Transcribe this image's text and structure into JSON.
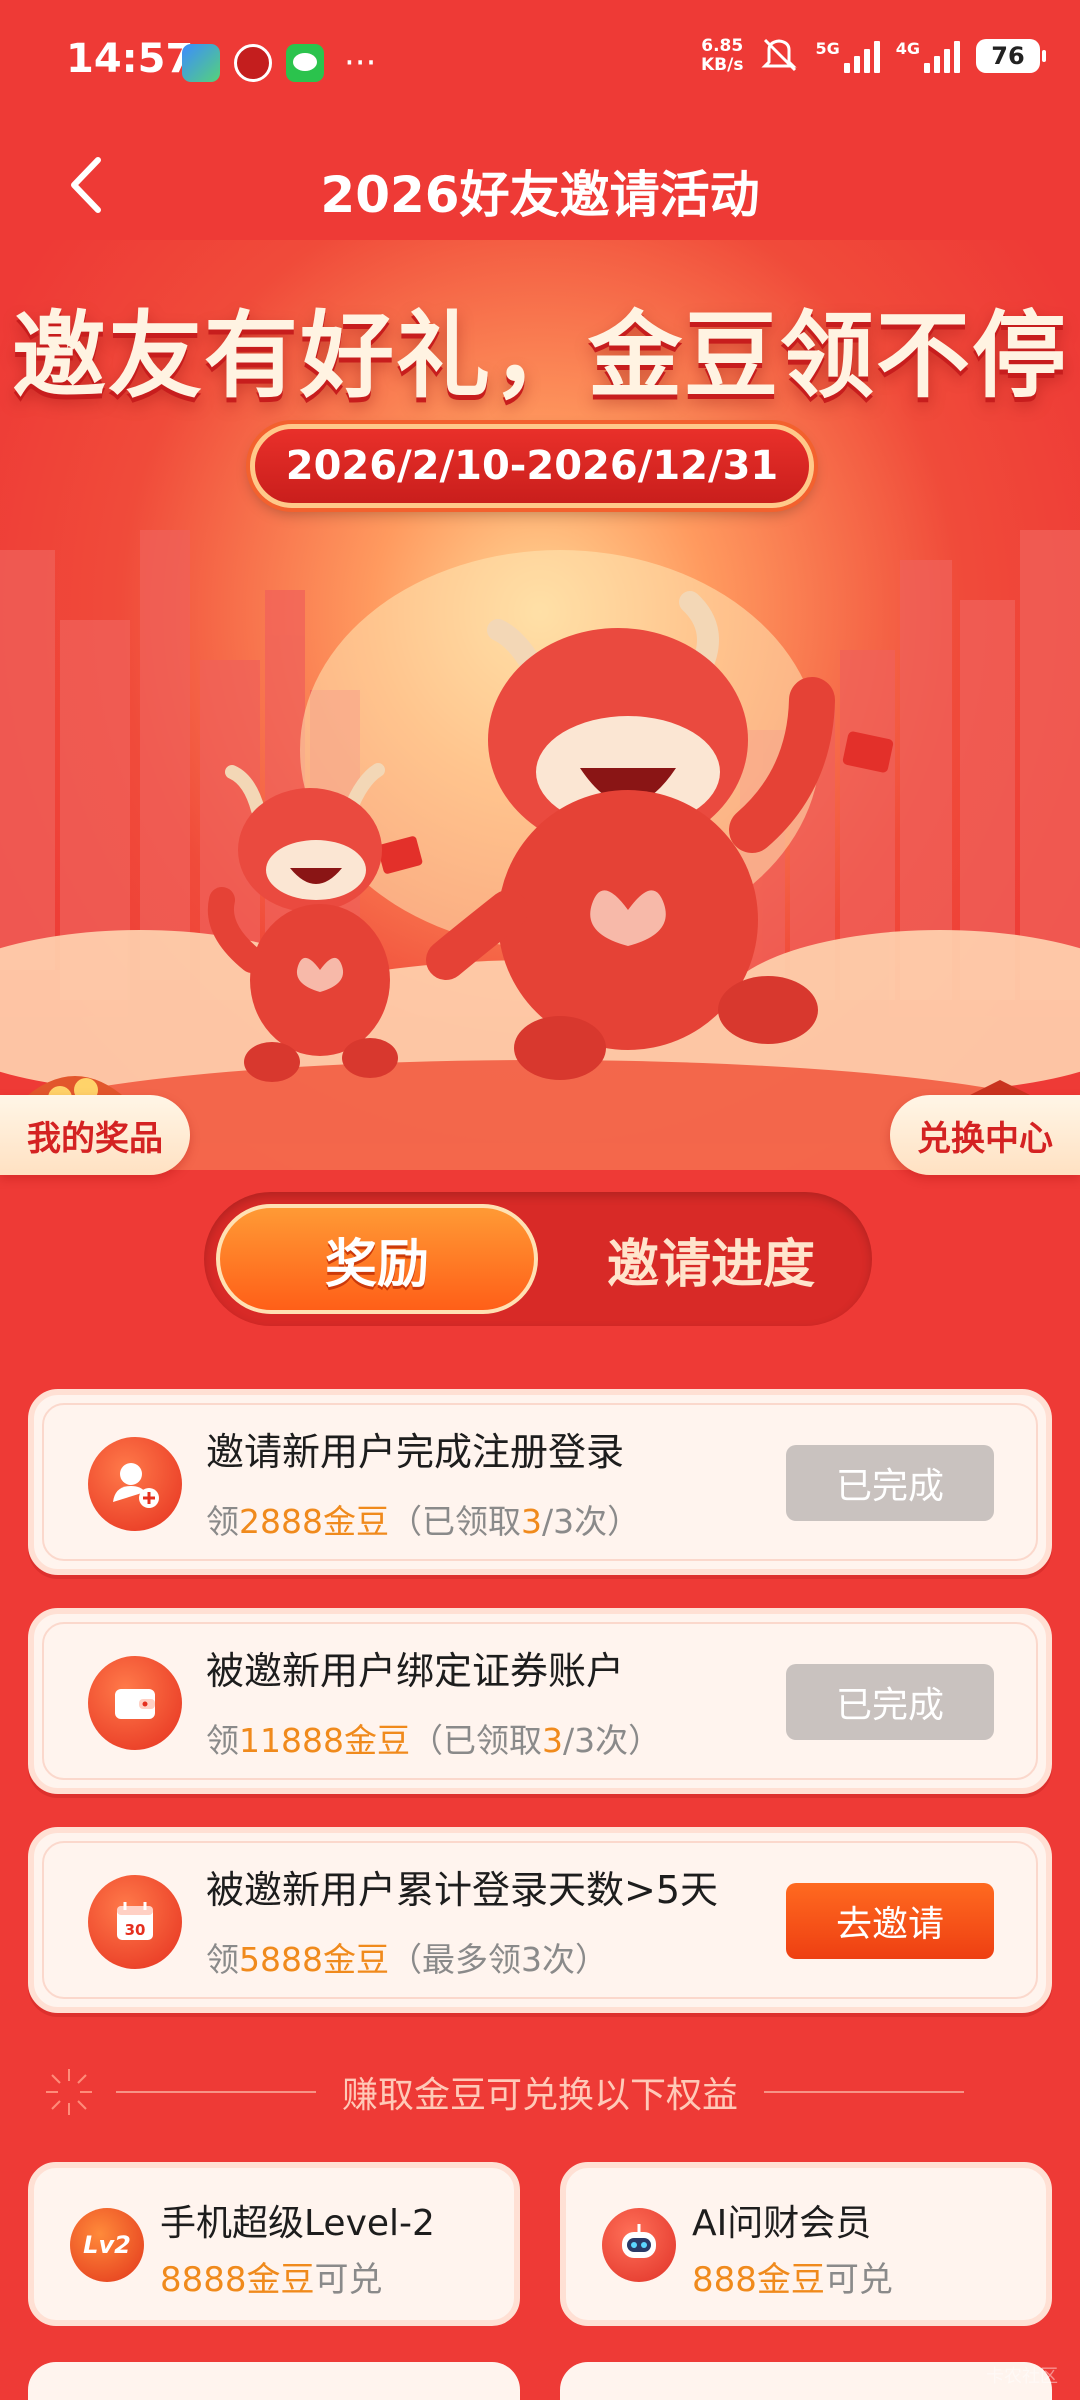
{
  "status_bar": {
    "time": "14:57",
    "speed_value": "6.85",
    "speed_unit": "KB/s",
    "net1": "5G",
    "net2": "4G",
    "battery": "76"
  },
  "header": {
    "title": "2026好友邀请活动",
    "back_icon": "chevron-left-icon"
  },
  "hero": {
    "headline": "邀友有好礼，金豆领不停",
    "date_range": "2026/2/10-2026/12/31",
    "left_tag": "我的奖品",
    "right_tag": "兑换中心"
  },
  "tabs": [
    {
      "label": "奖励",
      "active": true
    },
    {
      "label": "邀请进度",
      "active": false
    }
  ],
  "tasks": [
    {
      "icon": "add-user-icon",
      "title": "邀请新用户完成注册登录",
      "prefix": "领",
      "reward": "2888金豆",
      "detail_open": "（已领取",
      "claimed": "3",
      "detail_close": "/3次）",
      "button": "已完成",
      "done": true
    },
    {
      "icon": "wallet-icon",
      "title": "被邀新用户绑定证券账户",
      "prefix": "领",
      "reward": "11888金豆",
      "detail_open": "（已领取",
      "claimed": "3",
      "detail_close": "/3次）",
      "button": "已完成",
      "done": true
    },
    {
      "icon": "calendar-icon",
      "title": "被邀新用户累计登录天数>5天",
      "prefix": "领",
      "reward": "5888金豆",
      "detail": "（最多领3次）",
      "calendar_day": "30",
      "button": "去邀请",
      "done": false
    }
  ],
  "benefits_divider": "赚取金豆可兑换以下权益",
  "benefits": [
    {
      "icon": "level-badge-icon",
      "icon_text": "Lv2",
      "title": "手机超级Level-2",
      "price": "8888金豆",
      "suffix": "可兑"
    },
    {
      "icon": "robot-icon",
      "title": "AI问财会员",
      "price": "888金豆",
      "suffix": "可兑"
    }
  ],
  "watermark": "卡农社区",
  "colors": {
    "background": "#ee3a36",
    "accent_orange": "#f08a1c",
    "button_go": "#ee3f12",
    "button_done": "#c9c2bf"
  }
}
